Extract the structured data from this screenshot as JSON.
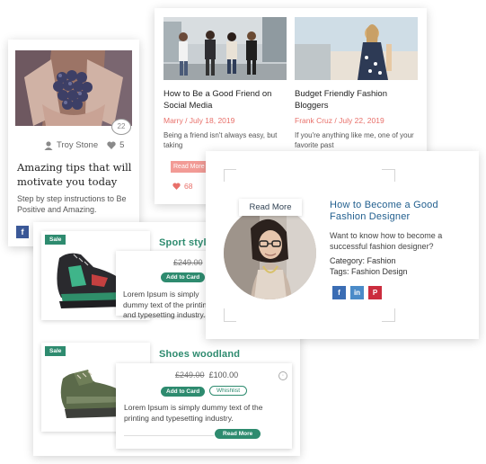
{
  "blog_card": {
    "comment_count": "22",
    "author": "Troy Stone",
    "likes": "5",
    "title": "Amazing tips that will motivate you today",
    "description": "Step by step instructions to Be Positive and Amazing.",
    "facebook_label": "f"
  },
  "posts_card": {
    "posts": [
      {
        "title": "How to Be a Good Friend on Social Media",
        "author": "Marry",
        "date": "July 18, 2019",
        "meta": "Marry / July 18, 2019",
        "excerpt": "Being a friend isn't  always easy, but taking"
      },
      {
        "title": "Budget Friendly  Fashion Bloggers",
        "author": "Frank Cruz",
        "date": "July 22, 2019",
        "meta": "Frank Cruz / July 22, 2019",
        "excerpt": "If you're anything like me, one of your favorite past"
      }
    ],
    "read_more": "Read More",
    "likes": "68"
  },
  "products_card": {
    "products": [
      {
        "badge": "Sale",
        "name": "Sport styl",
        "old_price": "£249.00",
        "new_price": "",
        "add_to_cart": "Add to Card",
        "description": "Lorem Ipsum is simply dummy text of the printing and typesetting industry."
      },
      {
        "badge": "Sale",
        "name": "Shoes woodland",
        "old_price": "£249.00",
        "new_price": "£100.00",
        "add_to_cart": "Add to Card",
        "wishlist": "Whishlist",
        "description": "Lorem Ipsum is simply dummy text of the printing and typesetting industry.",
        "read_more": "Read More"
      }
    ]
  },
  "author_card": {
    "read_more": "Read More",
    "title": "How to Become a Good Fashion Designer",
    "description": "Want to know how to become a successful fashion designer?",
    "category_label": "Category:",
    "category": "Fashion",
    "tags_label": "Tags:",
    "tags": "Fashion Design",
    "social": [
      {
        "name": "facebook",
        "glyph": "f",
        "color": "#3b6db4"
      },
      {
        "name": "linkedin",
        "glyph": "in",
        "color": "#4b8bc8"
      },
      {
        "name": "pinterest",
        "glyph": "P",
        "color": "#cb2d3e"
      }
    ]
  },
  "colors": {
    "accent_green": "#2e8b6f",
    "accent_red": "#e8706a",
    "link_blue": "#23608f"
  }
}
